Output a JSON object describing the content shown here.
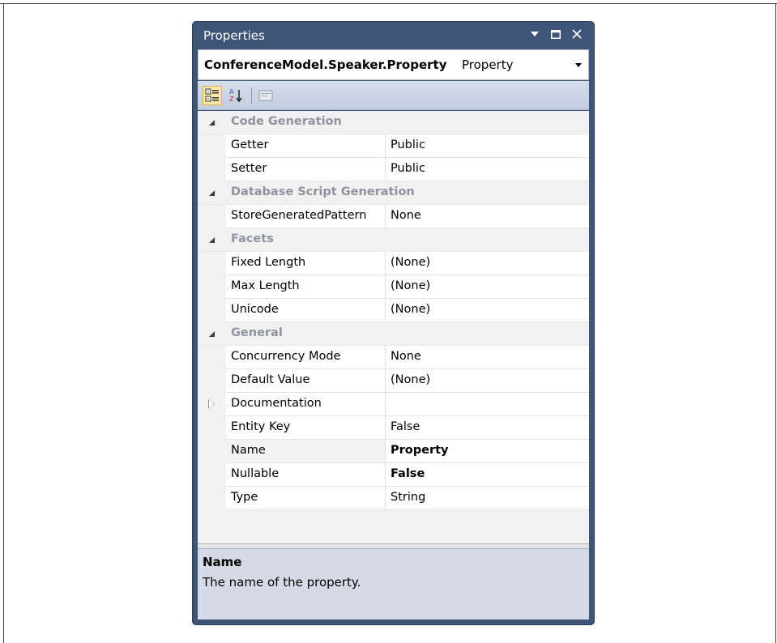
{
  "window": {
    "title": "Properties"
  },
  "object_selector": {
    "name": "ConferenceModel.Speaker.Property",
    "type": "Property"
  },
  "toolbar": {
    "buttons": [
      "categorized-icon",
      "alphabetical-icon",
      "property-pages-icon"
    ]
  },
  "grid": {
    "categories": [
      {
        "label": "Code Generation",
        "properties": [
          {
            "name": "Getter",
            "value": "Public"
          },
          {
            "name": "Setter",
            "value": "Public"
          }
        ]
      },
      {
        "label": "Database Script Generation",
        "properties": [
          {
            "name": "StoreGeneratedPattern",
            "value": "None"
          }
        ]
      },
      {
        "label": "Facets",
        "properties": [
          {
            "name": "Fixed Length",
            "value": "(None)"
          },
          {
            "name": "Max Length",
            "value": "(None)"
          },
          {
            "name": "Unicode",
            "value": "(None)"
          }
        ]
      },
      {
        "label": "General",
        "properties": [
          {
            "name": "Concurrency Mode",
            "value": "None"
          },
          {
            "name": "Default Value",
            "value": "(None)"
          },
          {
            "name": "Documentation",
            "value": ""
          },
          {
            "name": "Entity Key",
            "value": "False"
          },
          {
            "name": "Name",
            "value": "Property"
          },
          {
            "name": "Nullable",
            "value": "False"
          },
          {
            "name": "Type",
            "value": "String"
          }
        ]
      }
    ]
  },
  "description": {
    "title": "Name",
    "text": "The name of the property."
  },
  "colors": {
    "window_frame": "#3e5577",
    "category_text": "#8e949e",
    "toolbar_active": "#fbe5a8",
    "description_bg": "#d4dbe6"
  }
}
